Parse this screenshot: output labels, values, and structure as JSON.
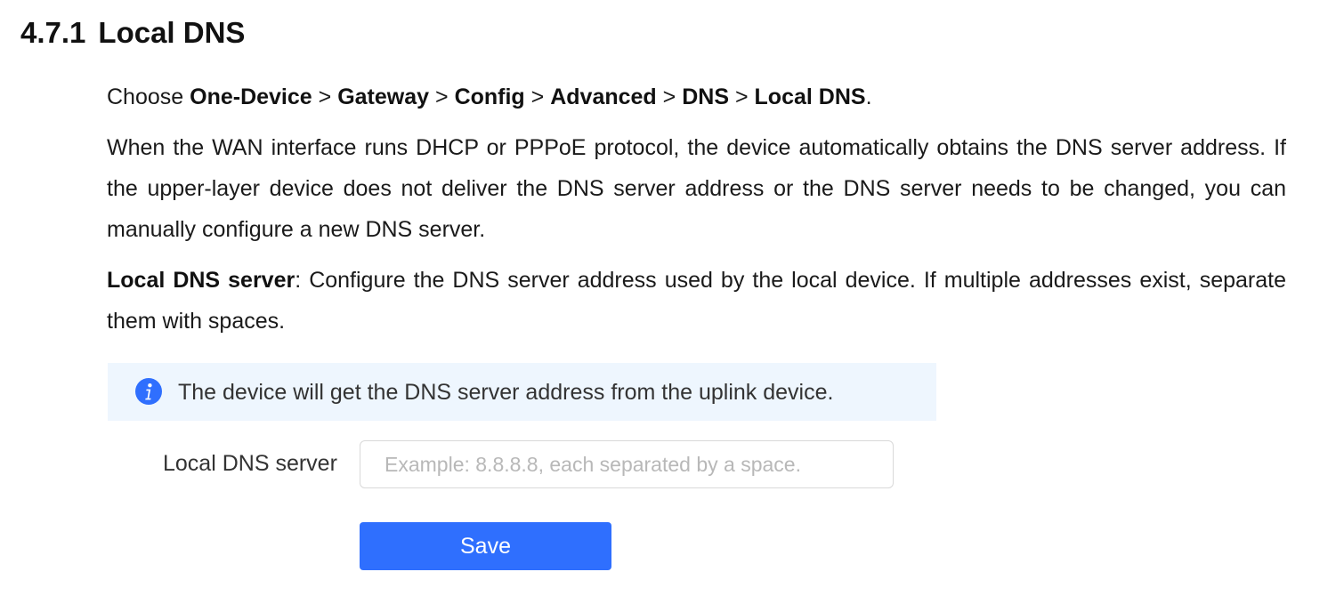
{
  "heading": {
    "number": "4.7.1",
    "title": "Local DNS"
  },
  "navigation": {
    "prefix": "Choose",
    "separator": ">",
    "path": [
      "One-Device",
      "Gateway",
      "Config",
      "Advanced",
      "DNS",
      "Local DNS"
    ],
    "end": "."
  },
  "description": "When the WAN interface runs DHCP or PPPoE protocol, the device automatically obtains the DNS server address. If the upper-layer device does not deliver the DNS server address or the DNS server needs to be changed, you can manually configure a new DNS server.",
  "field_note": {
    "term": "Local DNS server",
    "text": ": Configure the DNS server address used by the local device. If multiple addresses exist, separate them with spaces."
  },
  "panel": {
    "info_icon": "info-circle-icon",
    "info_message": "The device will get the DNS server address from the uplink device.",
    "field_label": "Local DNS server",
    "field_value": "",
    "field_placeholder": "Example: 8.8.8.8, each separated by a space.",
    "save_label": "Save"
  },
  "colors": {
    "accent": "#2f6ffe",
    "info_background": "#eef6fe",
    "info_icon": "#2f6ffe"
  }
}
